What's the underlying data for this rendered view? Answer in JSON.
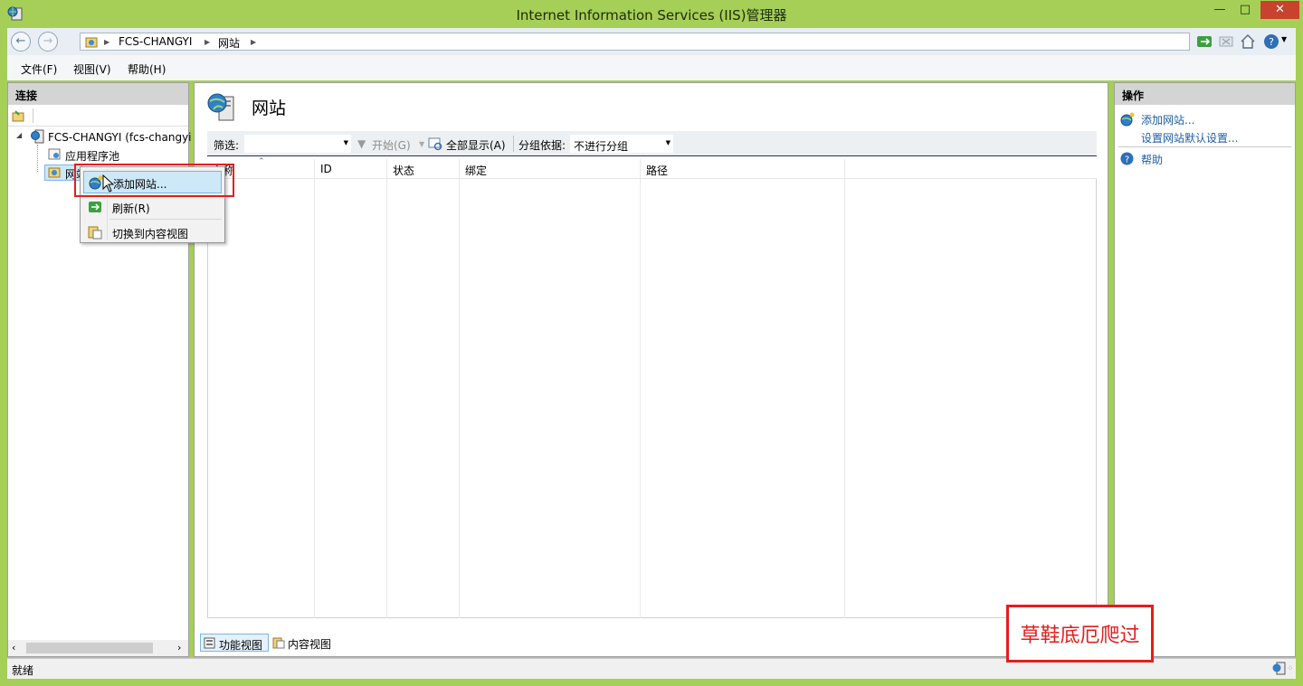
{
  "window": {
    "title": "Internet Information Services (IIS)管理器",
    "minimize": "—",
    "maximize": "□",
    "close": "✕"
  },
  "address": {
    "crumbs": [
      "FCS-CHANGYI",
      "网站"
    ]
  },
  "menu": {
    "items": [
      "文件(F)",
      "视图(V)",
      "帮助(H)"
    ]
  },
  "connections": {
    "header": "连接",
    "tree": {
      "server": "FCS-CHANGYI (fcs-changyi",
      "app_pools": "应用程序池",
      "sites": "网站"
    }
  },
  "main": {
    "title": "网站",
    "filter": {
      "label": "筛选:",
      "start": "开始(G)",
      "show_all": "全部显示(A)",
      "group_label": "分组依据:",
      "group_value": "不进行分组"
    },
    "columns": [
      "名称",
      "ID",
      "状态",
      "绑定",
      "路径"
    ],
    "view_tabs": [
      "功能视图",
      "内容视图"
    ]
  },
  "actions": {
    "header": "操作",
    "add_site": "添加网站...",
    "site_defaults": "设置网站默认设置...",
    "help": "帮助"
  },
  "context_menu": {
    "items": [
      "添加网站...",
      "刷新(R)",
      "切换到内容视图"
    ]
  },
  "status": {
    "text": "就绪"
  },
  "watermark": {
    "text": "草鞋底厄爬过"
  },
  "colors": {
    "frame": "#a5cf56",
    "highlight": "#e0201c",
    "link": "#1c5ea8",
    "ctx_hover": "#cde8f6"
  }
}
